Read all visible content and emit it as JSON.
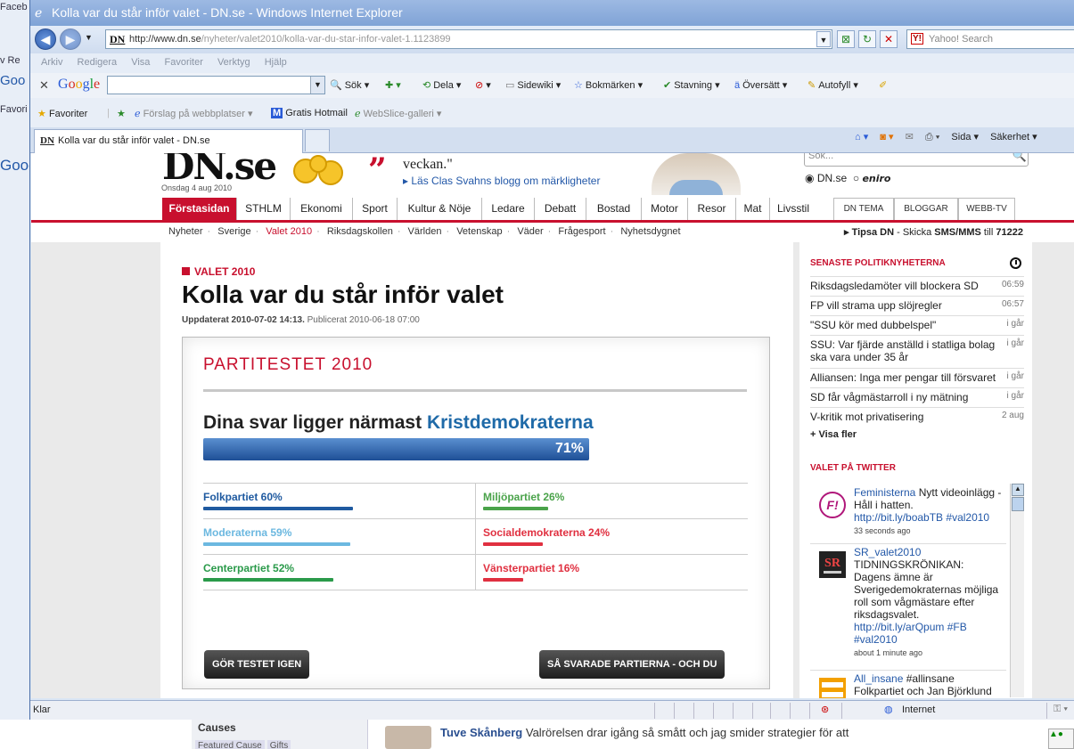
{
  "background_window": {
    "left_strip": [
      "Faceb",
      "v  Re",
      "Goo",
      "Favori",
      "Goog"
    ],
    "causes_title": "Causes",
    "causes_tabs": [
      "Featured Cause",
      "Gifts"
    ],
    "post_author": "Tuve Skånberg",
    "post_text": "Valrörelsen drar igång så smått och jag smider strategier för att"
  },
  "ie": {
    "title": "Kolla var du står inför valet - DN.se - Windows Internet Explorer",
    "address_host": "http://www.dn.se",
    "address_path": "/nyheter/valet2010/kolla-var-du-star-infor-valet-1.1123899",
    "search_placeholder": "Yahoo! Search",
    "menu": [
      "Arkiv",
      "Redigera",
      "Visa",
      "Favoriter",
      "Verktyg",
      "Hjälp"
    ],
    "google_toolbar": {
      "logo": "Google",
      "items": [
        "Sök ▾",
        "Dela ▾",
        "Sidewiki ▾",
        "Bokmärken ▾",
        "Stavning ▾",
        "Översätt ▾",
        "Autofyll ▾"
      ]
    },
    "favorites": {
      "label": "Favoriter",
      "items": [
        "Förslag på webbplatser ▾",
        "Gratis Hotmail",
        "WebSlice-galleri ▾"
      ]
    },
    "tab_title": "Kolla var du står inför valet - DN.se",
    "command_items": [
      "Sida ▾",
      "Säkerhet ▾"
    ],
    "status_text": "Klar",
    "status_zone": "Internet"
  },
  "dn": {
    "logo": "DN.se",
    "date": "Onsdag 4 aug 2010",
    "quote_text": "veckan.\"",
    "quote_link": "▸ Läs Clas Svahns blogg om märkligheter",
    "search_placeholder": "Sök...",
    "radio_dn": "DN.se",
    "radio_eniro": "eniro",
    "nav": [
      "Förstasidan",
      "STHLM",
      "Ekonomi",
      "Sport",
      "Kultur & Nöje",
      "Ledare",
      "Debatt",
      "Bostad",
      "Motor",
      "Resor",
      "Mat",
      "Livsstil"
    ],
    "nav_tabs": [
      "DN TEMA",
      "BLOGGAR",
      "WEBB-TV"
    ],
    "subnav": [
      "Nyheter",
      "Sverige",
      "Valet 2010",
      "Riksdagskollen",
      "Världen",
      "Vetenskap",
      "Väder",
      "Frågesport",
      "Nyhetsdygnet"
    ],
    "tipsa_prefix": "▸ Tipsa DN",
    "tipsa_mid": " - Skicka ",
    "tipsa_sms": "SMS/MMS",
    "tipsa_till": " till ",
    "tipsa_number": "71222"
  },
  "article": {
    "kicker": "VALET 2010",
    "headline": "Kolla var du står inför valet",
    "updated_label": "Uppdaterat 2010-07-02 14:13.",
    "published": " Publicerat 2010-06-18 07:00"
  },
  "quiz": {
    "title": "PARTITESTET 2010",
    "result_prefix": "Dina svar ligger närmast ",
    "result_party": "Kristdemokraterna",
    "result_percent_label": "71%",
    "result_percent": 71,
    "parties": [
      {
        "label": "Folkpartiet 60%",
        "value": 60,
        "color": "#1f5aa0"
      },
      {
        "label": "Miljöpartiet 26%",
        "value": 26,
        "color": "#4aa34a"
      },
      {
        "label": "Moderaterna 59%",
        "value": 59,
        "color": "#6cb8e0"
      },
      {
        "label": "Socialdemokraterna 24%",
        "value": 24,
        "color": "#e03040"
      },
      {
        "label": "Centerpartiet 52%",
        "value": 52,
        "color": "#2a9a4a"
      },
      {
        "label": "Vänsterpartiet 16%",
        "value": 16,
        "color": "#e03040"
      }
    ],
    "retry_button": "GÖR TESTET IGEN",
    "compare_button": "SÅ SVARADE PARTIERNA - OCH DU"
  },
  "sidebar": {
    "news_title": "SENASTE POLITIKNYHETERNA",
    "news": [
      {
        "title": "Riksdagsledamöter vill blockera SD",
        "time": "06:59"
      },
      {
        "title": "FP vill strama upp slöjregler",
        "time": "06:57"
      },
      {
        "title": "\"SSU kör med dubbelspel\"",
        "time": "i går"
      },
      {
        "title": "SSU: Var fjärde anställd i statliga bolag ska vara under 35 år",
        "time": "i går"
      },
      {
        "title": "Alliansen: Inga mer pengar till försvaret",
        "time": "i går"
      },
      {
        "title": "SD får vågmästarroll i ny mätning",
        "time": "i går"
      },
      {
        "title": "V-kritik mot privatisering",
        "time": "2 aug"
      }
    ],
    "more": "+ Visa fler",
    "twitter_title": "VALET PÅ TWITTER",
    "tweets": [
      {
        "user": "Feministerna",
        "text": " Nytt videoinlägg - Håll i hatten. ",
        "link": "http://bit.ly/boabTB #val2010",
        "ago": "33 seconds ago"
      },
      {
        "user": "SR_valet2010",
        "text": " TIDNINGSKRÖNIKAN: Dagens ämne är Sverigedemokraternas möjliga roll som vågmästare efter riksdagsvalet. ",
        "link": "http://bit.ly/arQpum #FB #val2010",
        "ago": "about 1 minute ago"
      },
      {
        "user": "All_insane",
        "text": " #allinsane Folkpartiet och Jan Björklund",
        "link": "",
        "ago": ""
      }
    ]
  }
}
